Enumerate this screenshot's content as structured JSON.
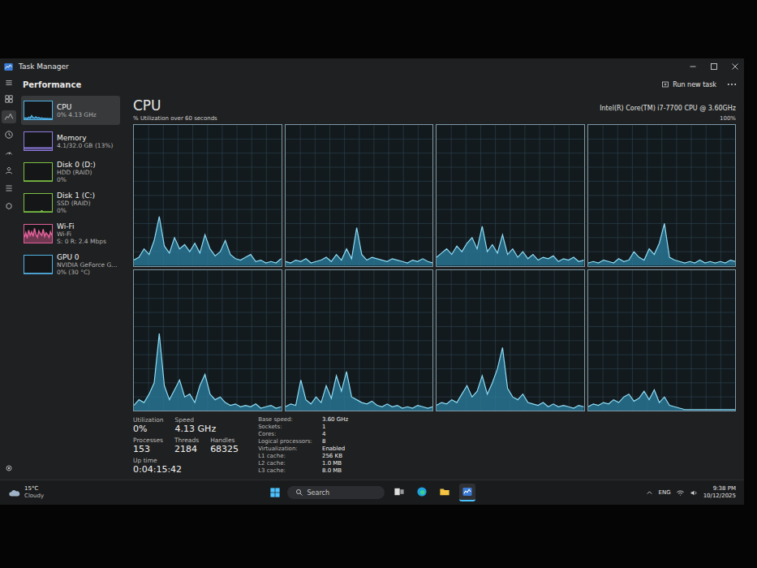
{
  "window": {
    "title": "Task Manager"
  },
  "nav_rail": [
    {
      "selected": false
    },
    {
      "selected": true
    },
    {
      "selected": false
    },
    {
      "selected": false
    },
    {
      "selected": false
    },
    {
      "selected": false
    },
    {
      "selected": false
    }
  ],
  "header": {
    "title": "Performance",
    "action": "Run new task"
  },
  "sidebar": {
    "items": [
      {
        "title": "CPU",
        "details": [
          "0% 4.13 GHz"
        ],
        "selected": true,
        "color": "#4fb3e8",
        "graph": [
          5,
          8,
          4,
          12,
          6,
          20,
          9,
          7,
          14,
          6,
          10,
          5,
          8,
          4,
          6,
          3,
          5,
          4,
          3,
          2
        ]
      },
      {
        "title": "Memory",
        "details": [
          "4.1/32.0 GB (13%)"
        ],
        "selected": false,
        "color": "#8f7ae0",
        "graph": [
          13,
          13,
          13,
          13,
          13,
          13,
          13,
          13,
          13,
          13,
          13,
          13,
          13,
          13,
          13,
          13,
          13,
          13,
          13,
          13
        ]
      },
      {
        "title": "Disk 0 (D:)",
        "details": [
          "HDD (RAID)",
          "0%"
        ],
        "selected": false,
        "color": "#7bc043",
        "graph": [
          0,
          0,
          0,
          0,
          0,
          0,
          0,
          0,
          0,
          0,
          0,
          0,
          0,
          0,
          0,
          0,
          0,
          0,
          0,
          0
        ]
      },
      {
        "title": "Disk 1 (C:)",
        "details": [
          "SSD (RAID)",
          "0%"
        ],
        "selected": false,
        "color": "#7bc043",
        "graph": [
          0,
          0,
          0,
          0,
          0,
          0,
          0,
          0,
          0,
          0,
          0,
          0,
          6,
          0,
          0,
          0,
          0,
          0,
          0,
          0
        ]
      },
      {
        "title": "Wi-Fi",
        "details": [
          "Wi-Fi",
          "S: 0 R: 2.4 Mbps"
        ],
        "selected": false,
        "color": "#e0609a",
        "graph": [
          30,
          55,
          25,
          70,
          40,
          60,
          35,
          80,
          45,
          30,
          65,
          50,
          40,
          75,
          35,
          55,
          45,
          30,
          60,
          40
        ]
      },
      {
        "title": "GPU 0",
        "details": [
          "NVIDIA GeForce G...",
          "0% (30 °C)"
        ],
        "selected": false,
        "color": "#4fb3e8",
        "graph": [
          0,
          0,
          0,
          0,
          0,
          0,
          0,
          0,
          0,
          0,
          0,
          0,
          0,
          0,
          0,
          0,
          0,
          0,
          0,
          0
        ]
      }
    ]
  },
  "chart": {
    "title": "CPU",
    "subtitle": "% Utilization over 60 seconds",
    "processor": "Intel(R) Core(TM) i7-7700 CPU @ 3.60GHz",
    "max_label": "100%",
    "series": [
      {
        "values": [
          4,
          6,
          12,
          8,
          18,
          35,
          14,
          9,
          20,
          12,
          15,
          10,
          16,
          9,
          22,
          12,
          7,
          10,
          18,
          8,
          5,
          4,
          6,
          8,
          3,
          4,
          2,
          3,
          2,
          5
        ]
      },
      {
        "values": [
          3,
          2,
          4,
          3,
          5,
          2,
          3,
          4,
          6,
          3,
          8,
          4,
          12,
          5,
          27,
          8,
          4,
          6,
          5,
          4,
          3,
          5,
          4,
          3,
          2,
          4,
          3,
          5,
          3,
          2
        ]
      },
      {
        "values": [
          6,
          9,
          12,
          8,
          14,
          10,
          16,
          20,
          12,
          28,
          10,
          15,
          9,
          22,
          8,
          12,
          6,
          10,
          5,
          8,
          4,
          6,
          5,
          7,
          3,
          5,
          4,
          6,
          3,
          4
        ]
      },
      {
        "values": [
          2,
          3,
          2,
          4,
          3,
          2,
          5,
          3,
          4,
          10,
          6,
          4,
          12,
          8,
          16,
          30,
          6,
          4,
          3,
          2,
          3,
          2,
          4,
          2,
          3,
          2,
          3,
          2,
          4,
          3
        ]
      },
      {
        "values": [
          4,
          8,
          6,
          12,
          20,
          55,
          18,
          8,
          15,
          22,
          10,
          12,
          6,
          18,
          26,
          12,
          8,
          10,
          6,
          4,
          5,
          3,
          4,
          3,
          5,
          2,
          3,
          4,
          2,
          3
        ]
      },
      {
        "values": [
          3,
          5,
          4,
          22,
          8,
          5,
          10,
          6,
          18,
          9,
          25,
          14,
          28,
          10,
          8,
          6,
          5,
          7,
          4,
          3,
          5,
          3,
          4,
          2,
          3,
          2,
          4,
          3,
          2,
          3
        ]
      },
      {
        "values": [
          4,
          6,
          5,
          8,
          6,
          12,
          18,
          10,
          14,
          25,
          12,
          20,
          30,
          45,
          16,
          10,
          8,
          12,
          6,
          5,
          4,
          6,
          3,
          5,
          3,
          4,
          3,
          2,
          4,
          3
        ]
      },
      {
        "values": [
          3,
          5,
          4,
          6,
          5,
          8,
          6,
          10,
          12,
          7,
          9,
          14,
          8,
          15,
          6,
          10,
          4,
          3,
          2,
          1,
          1,
          1,
          1,
          1,
          1,
          1,
          1,
          1,
          1,
          1
        ]
      }
    ]
  },
  "stats": {
    "rows": [
      [
        {
          "label": "Utilization",
          "value": "0%"
        },
        {
          "label": "Speed",
          "value": "4.13 GHz"
        }
      ],
      [
        {
          "label": "Processes",
          "value": "153"
        },
        {
          "label": "Threads",
          "value": "2184"
        },
        {
          "label": "Handles",
          "value": "68325"
        }
      ],
      [
        {
          "label": "Up time",
          "value": "0:04:15:42"
        }
      ]
    ],
    "details": [
      {
        "label": "Base speed:",
        "value": "3.60 GHz"
      },
      {
        "label": "Sockets:",
        "value": "1"
      },
      {
        "label": "Cores:",
        "value": "4"
      },
      {
        "label": "Logical processors:",
        "value": "8"
      },
      {
        "label": "Virtualization:",
        "value": "Enabled"
      },
      {
        "label": "L1 cache:",
        "value": "256 KB"
      },
      {
        "label": "L2 cache:",
        "value": "1.0 MB"
      },
      {
        "label": "L3 cache:",
        "value": "8.0 MB"
      }
    ]
  },
  "taskbar": {
    "weather": {
      "temperature": "15°C",
      "condition": "Cloudy"
    },
    "search": {
      "placeholder": "Search"
    },
    "apps": [
      {
        "selected": false
      },
      {
        "selected": false
      },
      {
        "selected": false
      },
      {
        "selected": true
      }
    ],
    "tray": {
      "language": "ENG",
      "time": "9:38 PM",
      "date": "10/12/2025"
    }
  }
}
